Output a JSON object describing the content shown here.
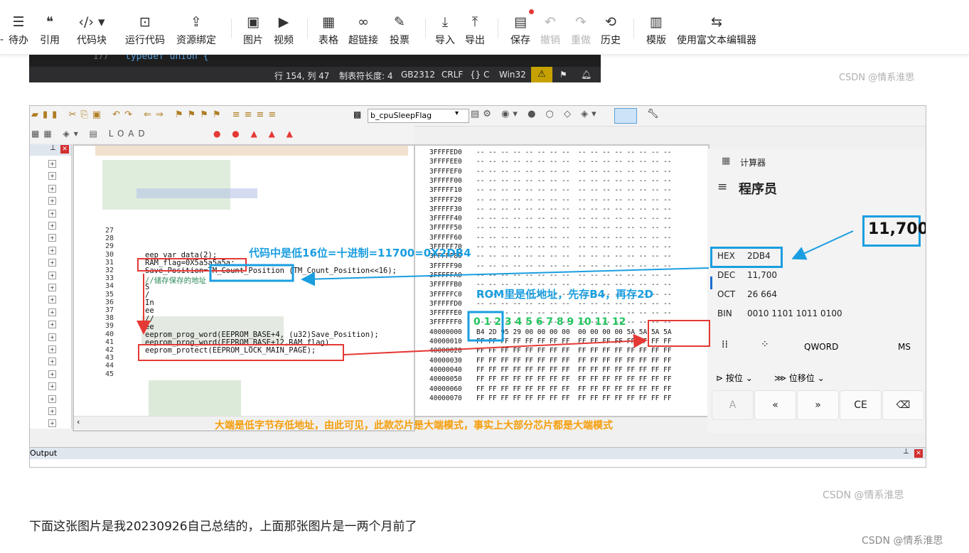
{
  "toolbar": {
    "items": [
      {
        "label": "待办",
        "icon": "todo-list-icon",
        "glyph": "☰"
      },
      {
        "label": "引用",
        "icon": "quote-icon",
        "glyph": "❝"
      },
      {
        "label": "代码块",
        "icon": "code-block-icon",
        "glyph": "‹/› ▾"
      },
      {
        "label": "运行代码",
        "icon": "run-code-icon",
        "glyph": "⊡"
      },
      {
        "label": "资源绑定",
        "icon": "resource-bind-icon",
        "glyph": "⇪"
      },
      {
        "label": "图片",
        "icon": "image-icon",
        "glyph": "▣"
      },
      {
        "label": "视频",
        "icon": "video-icon",
        "glyph": "▶"
      },
      {
        "label": "表格",
        "icon": "table-icon",
        "glyph": "▦"
      },
      {
        "label": "超链接",
        "icon": "link-icon",
        "glyph": "∞"
      },
      {
        "label": "投票",
        "icon": "vote-icon",
        "glyph": "✎"
      },
      {
        "label": "导入",
        "icon": "import-icon",
        "glyph": "⤓"
      },
      {
        "label": "导出",
        "icon": "export-icon",
        "glyph": "⤒"
      },
      {
        "label": "保存",
        "icon": "save-icon",
        "glyph": "▤"
      },
      {
        "label": "撤销",
        "icon": "undo-icon",
        "glyph": "↶"
      },
      {
        "label": "重做",
        "icon": "redo-icon",
        "glyph": "↷"
      },
      {
        "label": "历史",
        "icon": "history-icon",
        "glyph": "⟲"
      },
      {
        "label": "模版",
        "icon": "template-icon",
        "glyph": "▥"
      },
      {
        "label": "使用富文本编辑器",
        "icon": "switch-editor-icon",
        "glyph": "⇆"
      }
    ],
    "partial_left_char": "-"
  },
  "ide_status": {
    "code_line_num": "177",
    "code_fragment": "typedef union {",
    "position": "行 154, 列 47",
    "tab_size": "制表符长度: 4",
    "encoding": "GB2312",
    "eol": "CRLF",
    "lang": "{} C",
    "platform": "Win32"
  },
  "watermark_top": "CSDN @情系淮思",
  "watermark_mid": "CSDN @情系淮思",
  "watermark_bottom": "CSDN @情系淮思",
  "screenshot": {
    "function_box": "b_cpuSleepFlag",
    "output_label": "Output",
    "line_numbers": [
      "27",
      "28",
      "29",
      "30",
      "31",
      "32",
      "33",
      "34",
      "35",
      "36",
      "37",
      "38",
      "39",
      "40",
      "41",
      "42",
      "43",
      "44",
      "45"
    ],
    "code_lines": [
      "eep_var_data(2);",
      "RAM_flag=0X5a5a5a5a;",
      "Save_Position=TM_Count_Position (TM_Count_Position<<16);",
      "//储存保存的地址",
      "S",
      "/",
      "In",
      "ee",
      "//",
      "ee",
      "eeprom_prog_word(EEPROM_BASE+4, (u32)Save_Position);",
      "eeprom_prog_word(EEPROM_BASE+12,RAM_flag)",
      "eeprom_protect(EEPROM_LOCK_MAIN_PAGE);"
    ],
    "mem_addresses": [
      "3FFFFED0",
      "3FFFFEE0",
      "3FFFFEF0",
      "3FFFFF00",
      "3FFFFF10",
      "3FFFFF20",
      "3FFFFF30",
      "3FFFFF40",
      "3FFFFF50",
      "3FFFFF60",
      "3FFFFF70",
      "3FFFFF80",
      "3FFFFF90",
      "3FFFFFA0",
      "3FFFFFB0",
      "3FFFFFC0",
      "3FFFFFD0",
      "3FFFFFE0",
      "3FFFFFF0",
      "40000000",
      "40000010",
      "40000020",
      "40000030",
      "40000040",
      "40000050",
      "40000060",
      "40000070"
    ],
    "mem_row_dash": "-- -- -- -- -- -- -- --  -- -- -- -- -- -- -- --",
    "mem_row_ff": "FF FF FF FF FF FF FF FF  FF FF FF FF FF FF FF FF",
    "mem_row_40000000": "B4 2D 95 29 00 00 00 00  00 00 00 00 5A 5A 5A 5A",
    "calc": {
      "title": "计算器",
      "mode": "程序员",
      "display": "11,700",
      "rows": [
        {
          "label": "HEX",
          "value": "2DB4"
        },
        {
          "label": "DEC",
          "value": "11,700"
        },
        {
          "label": "OCT",
          "value": "26 664"
        },
        {
          "label": "BIN",
          "value": "0010 1101 1011 0100"
        }
      ],
      "word_size": "QWORD",
      "ms": "MS",
      "bitwise": "按位",
      "bitshift": "位移位",
      "keys": [
        "A",
        "«",
        "»",
        "CE",
        "⌫"
      ]
    },
    "annotations": {
      "code_low16": "代码中是低16位=十进制=11700=0X2DB4",
      "rom_low": "ROM里是低地址，先存B4，再存2D",
      "index_row": "0 1 2 3 4 5 6 7  8 9 10 11 12",
      "big_endian": "大端是低字节存低地址，由此可见，此款芯片是大端模式，事实上大部分芯片都是大端模式"
    }
  },
  "body_text": "下面这张图片是我20230926自己总结的，上面那张图片是一两个月前了",
  "colors": {
    "red": "#e53935",
    "blue": "#1a9ee0",
    "green": "#22c55e",
    "orange": "#f59e0b"
  }
}
